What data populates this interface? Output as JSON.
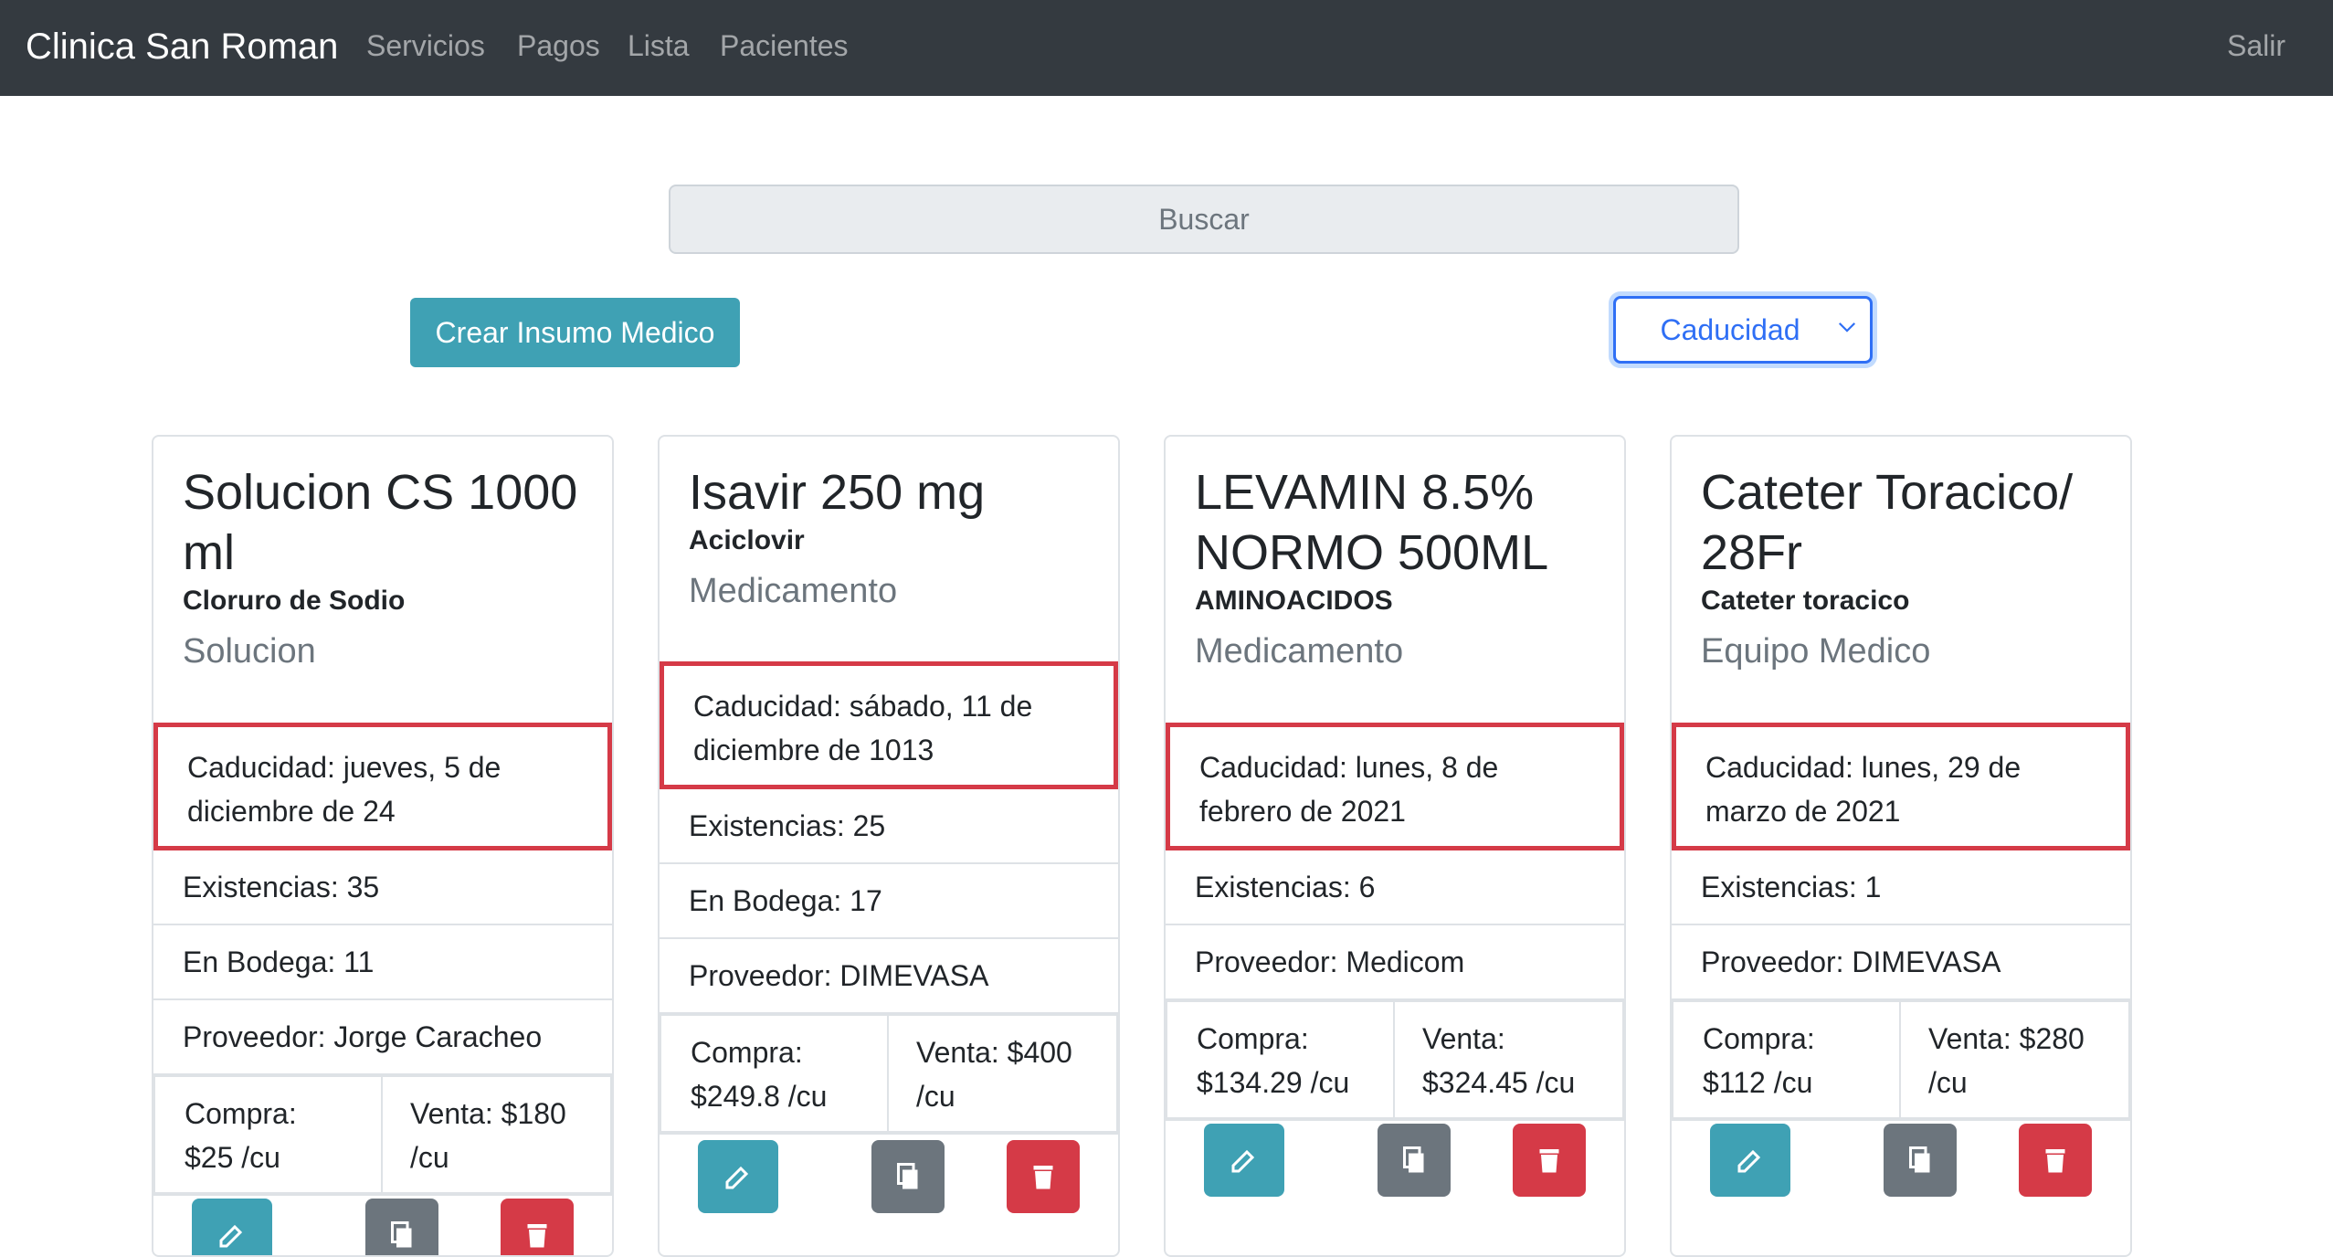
{
  "navbar": {
    "brand": "Clinica San Roman",
    "links": [
      "Servicios",
      "Pagos",
      "Lista",
      "Pacientes"
    ],
    "logout": "Salir"
  },
  "search": {
    "placeholder": "Buscar"
  },
  "create_button": "Crear Insumo Medico",
  "sort": {
    "selected": "Caducidad"
  },
  "colors": {
    "navbar": "#343a40",
    "info": "#3fa1b4",
    "secondary": "#6c757d",
    "danger": "#d53a47",
    "primary": "#2f6ff5"
  },
  "cards": [
    {
      "title": "Solucion CS 1000 ml",
      "subtitle": "Cloruro de Sodio",
      "category": "Solucion",
      "expiry": "Caducidad: jueves, 5 de diciembre de 24",
      "rows": [
        "Existencias: 35",
        "En Bodega: 11",
        "Proveedor: Jorge Caracheo"
      ],
      "buy": "Compra: $25 /cu",
      "sell": "Venta: $180 /cu"
    },
    {
      "title": "Isavir 250 mg",
      "subtitle": "Aciclovir",
      "category": "Medicamento",
      "expiry": "Caducidad: sábado, 11 de diciembre de 1013",
      "rows": [
        "Existencias: 25",
        "En Bodega: 17",
        "Proveedor: DIMEVASA"
      ],
      "buy": "Compra: $249.8 /cu",
      "sell": "Venta: $400 /cu"
    },
    {
      "title": "LEVAMIN 8.5% NORMO 500ML",
      "subtitle": "AMINOACIDOS",
      "category": "Medicamento",
      "expiry": "Caducidad: lunes, 8 de febrero de 2021",
      "rows": [
        "Existencias: 6",
        "Proveedor: Medicom"
      ],
      "buy": "Compra: $134.29 /cu",
      "sell": "Venta: $324.45 /cu"
    },
    {
      "title": "Cateter Toracico/ 28Fr",
      "subtitle": "Cateter toracico",
      "category": "Equipo Medico",
      "expiry": "Caducidad: lunes, 29 de marzo de 2021",
      "rows": [
        "Existencias: 1",
        "Proveedor: DIMEVASA"
      ],
      "buy": "Compra: $112 /cu",
      "sell": "Venta: $280 /cu"
    }
  ]
}
